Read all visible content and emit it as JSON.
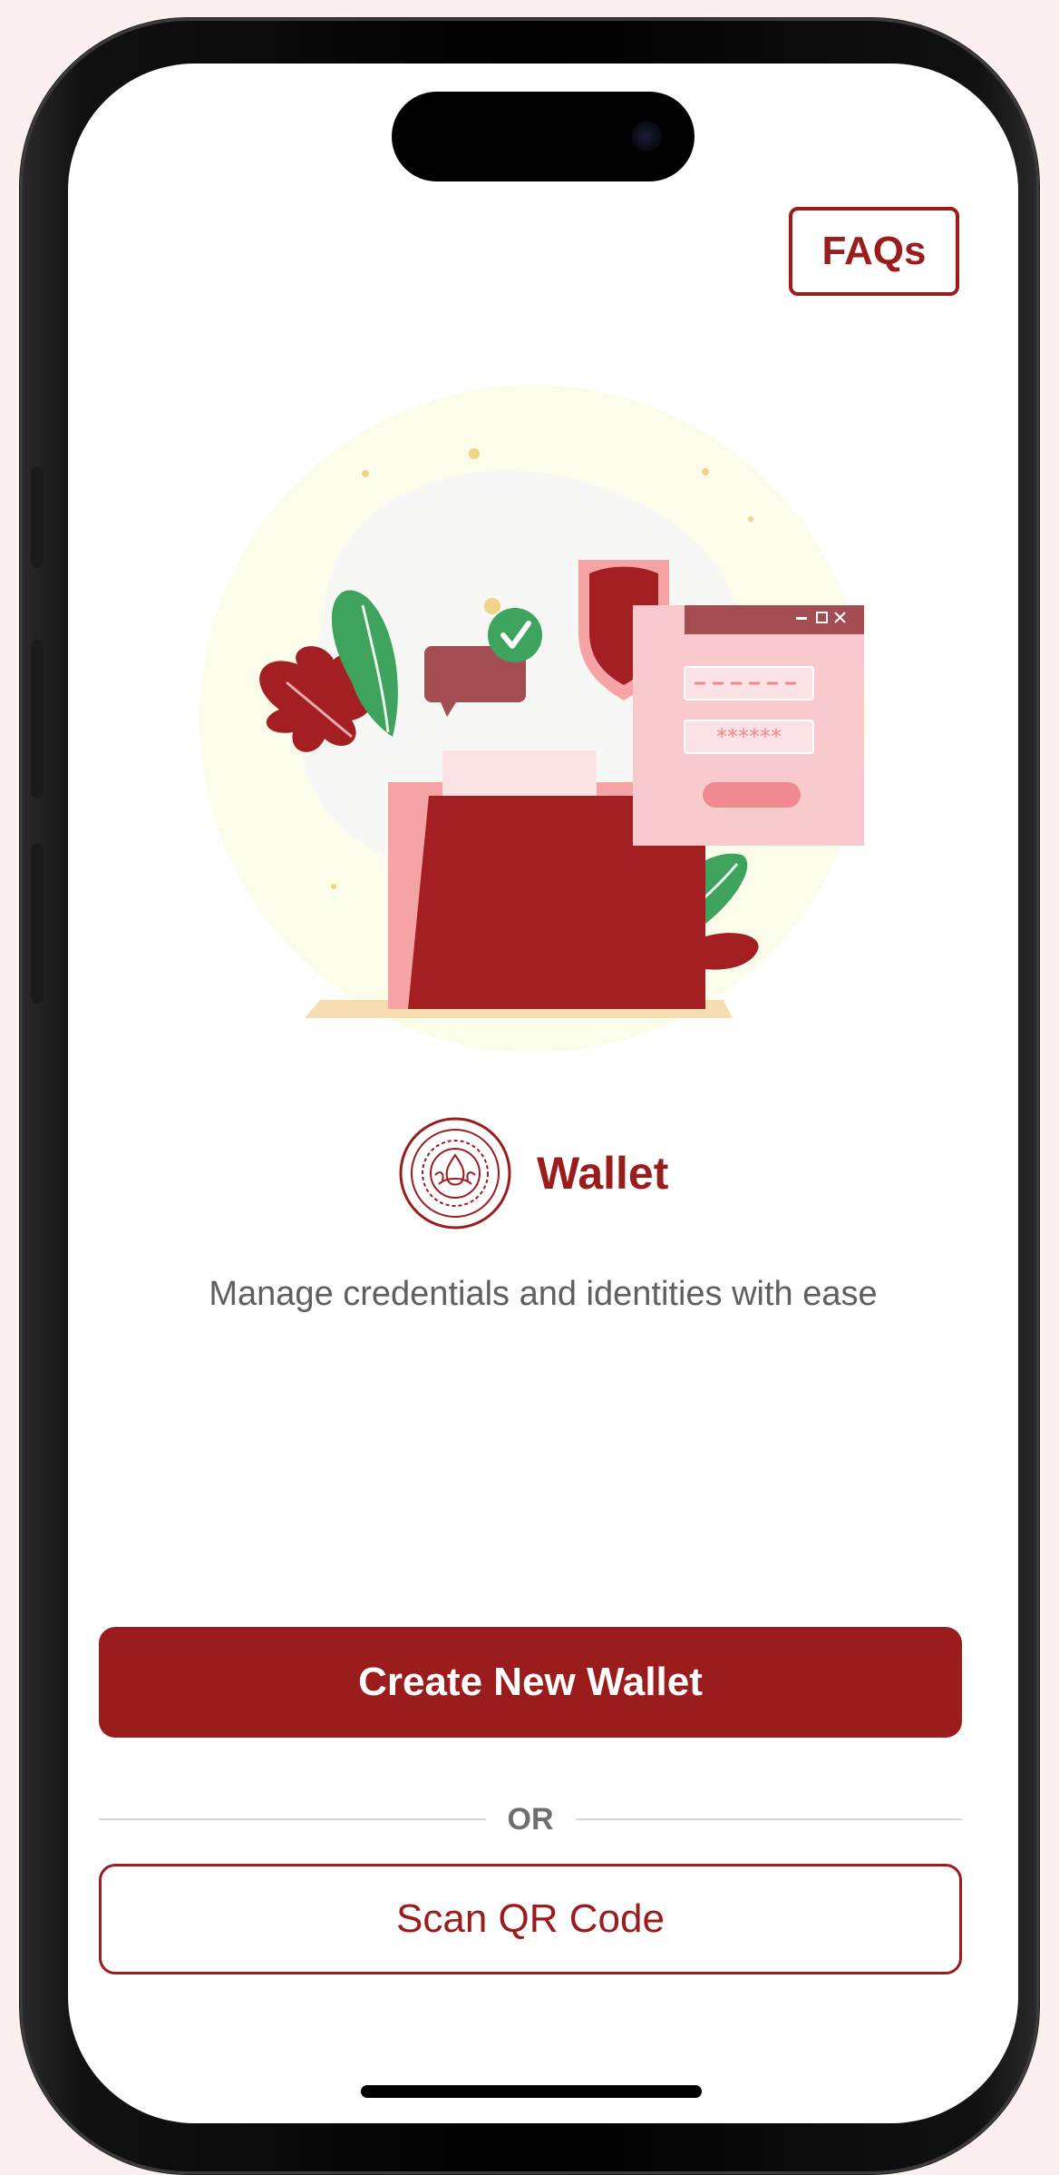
{
  "header": {
    "faq_label": "FAQs"
  },
  "brand": {
    "logo_icon": "institute-seal-icon",
    "name": "Wallet"
  },
  "tagline": "Manage credentials and identities with ease",
  "actions": {
    "primary_label": "Create New Wallet",
    "divider_label": "OR",
    "secondary_label": "Scan QR Code"
  },
  "illustration": {
    "icons": [
      "folder-icon",
      "shield-icon",
      "login-window-icon",
      "checkmark-icon",
      "chat-bubble-icon",
      "leaf-icon"
    ],
    "password_mask": "******"
  },
  "colors": {
    "brand": "#9B1C1C",
    "brand_light": "#F7C9CB",
    "accent_green": "#3DA35D",
    "background": "#FFFFFF"
  }
}
